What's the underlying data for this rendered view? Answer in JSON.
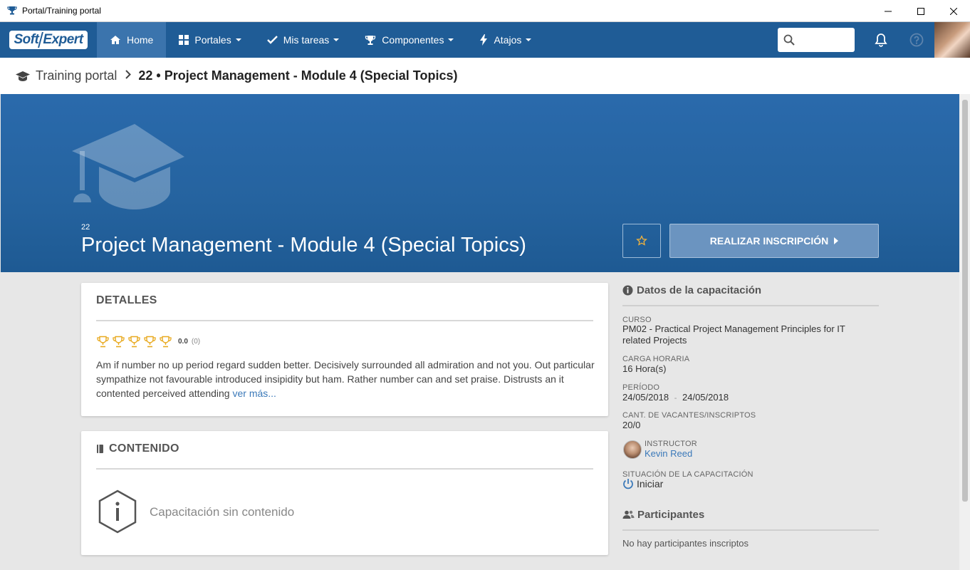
{
  "window": {
    "title": "Portal/Training portal"
  },
  "navbar": {
    "logo_left": "Soft",
    "logo_right": "Expert",
    "items": [
      {
        "label": "Home",
        "icon": "home-icon"
      },
      {
        "label": "Portales",
        "icon": "grid-icon"
      },
      {
        "label": "Mis tareas",
        "icon": "check-icon"
      },
      {
        "label": "Componentes",
        "icon": "trophy-icon"
      },
      {
        "label": "Atajos",
        "icon": "bolt-icon"
      }
    ],
    "search_placeholder": ""
  },
  "breadcrumb": {
    "root": "Training portal",
    "current": "22 • Project Management - Module 4 (Special Topics)"
  },
  "hero": {
    "code": "22",
    "title": "Project Management - Module 4 (Special Topics)",
    "enroll_label": "REALIZAR INSCRIPCIÓN"
  },
  "details": {
    "heading": "DETALLES",
    "rating_score": "0.0",
    "rating_count": "(0)",
    "rating_stars": 0,
    "description": "Am if number no up period regard sudden better. Decisively surrounded all admiration and not you. Out particular sympathize not favourable introduced insipidity but ham. Rather number can and set praise. Distrusts an it contented perceived attending",
    "more_link": "ver más..."
  },
  "content": {
    "heading": "CONTENIDO",
    "empty_text": "Capacitación sin contenido"
  },
  "training_data": {
    "heading": "Datos de la capacitación",
    "course_label": "CURSO",
    "course_value": "PM02 - Practical Project Management Principles for IT related Projects",
    "hours_label": "CARGA HORARIA",
    "hours_value": "16 Hora(s)",
    "period_label": "PERÍODO",
    "period_start": "24/05/2018",
    "period_sep": "-",
    "period_end": "24/05/2018",
    "vacancies_label": "CANT. DE VACANTES/INSCRIPTOS",
    "vacancies_value": "20/0",
    "instructor_label": "INSTRUCTOR",
    "instructor_name": "Kevin Reed",
    "status_label": "SITUACIÓN DE LA CAPACITACIÓN",
    "status_value": "Iniciar"
  },
  "participants": {
    "heading": "Participantes",
    "empty_text": "No hay participantes inscriptos"
  },
  "colors": {
    "nav": "#1f5c96",
    "nav_active": "#3b74ad",
    "hero": "#2a6aac",
    "link": "#3b79b9",
    "trophy": "#e8a91e"
  }
}
